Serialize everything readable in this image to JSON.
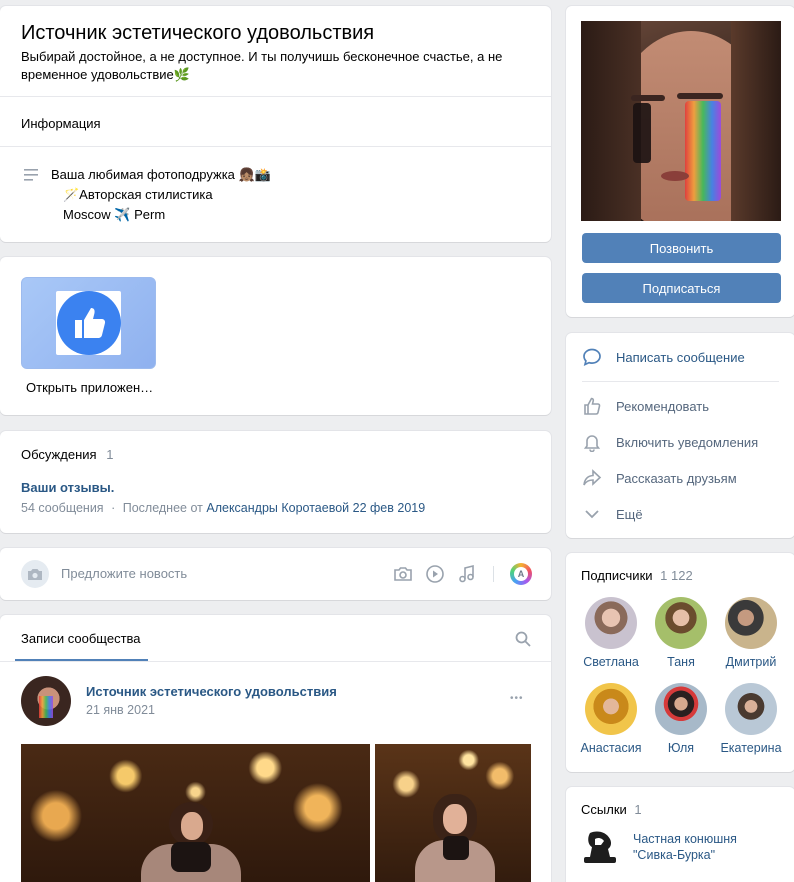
{
  "header": {
    "title": "Источник эстетического удовольствия",
    "status": "Выбирай достойное, а не доступное. И ты получишь бесконечное счастье, а не временное удовольствие🌿"
  },
  "info": {
    "heading": "Информация",
    "lines": [
      "Ваша любимая фотоподружка 👧🏽📸",
      "🪄Авторская стилистика",
      "Moscow ✈️ Perm"
    ]
  },
  "app": {
    "label": "Открыть приложен…"
  },
  "discussions": {
    "heading": "Обсуждения",
    "count": "1",
    "topic": "Ваши отзывы.",
    "messages": "54 сообщения",
    "sep": "·",
    "last_prefix": "Последнее от",
    "last_author": "Александры Коротаевой",
    "last_date": "22 фев 2019"
  },
  "composer": {
    "placeholder": "Предложите новость"
  },
  "wall": {
    "tab": "Записи сообщества",
    "post_author": "Источник эстетического удовольствия",
    "post_date": "21 янв 2021",
    "more": "•••"
  },
  "side": {
    "call_button": "Позвонить",
    "subscribe_button": "Подписаться",
    "actions": {
      "message": "Написать сообщение",
      "recommend": "Рекомендовать",
      "notify": "Включить уведомления",
      "share": "Рассказать друзьям",
      "more": "Ещё"
    }
  },
  "subscribers": {
    "heading": "Подписчики",
    "count": "1 122",
    "people": [
      "Светлана",
      "Таня",
      "Дмитрий",
      "Анастасия",
      "Юля",
      "Екатерина"
    ]
  },
  "links": {
    "heading": "Ссылки",
    "count": "1",
    "item_line1": "Частная конюшня",
    "item_line2": "\"Сивка-Бурка\""
  },
  "colors": {
    "accent": "#5181b8",
    "link": "#2a5885",
    "muted": "#818c99",
    "bg": "#edeef0"
  }
}
